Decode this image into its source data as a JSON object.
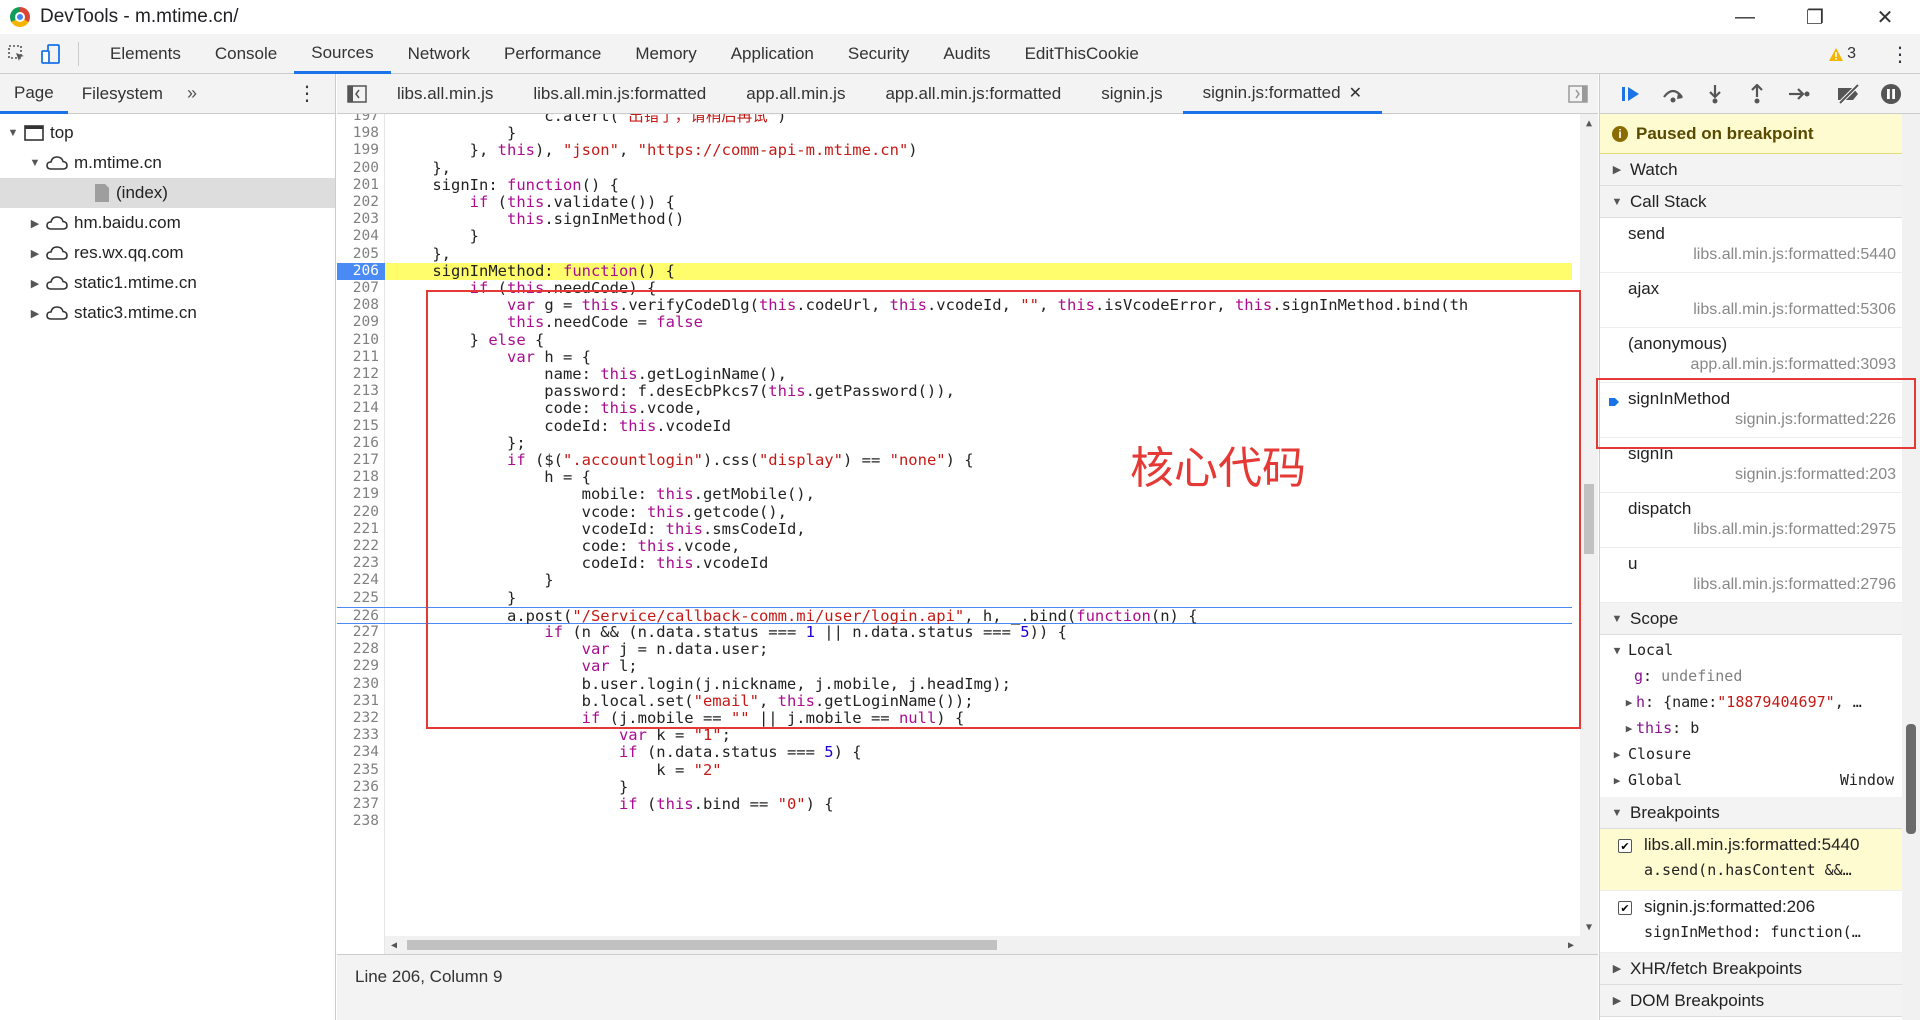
{
  "window": {
    "title": "DevTools - m.mtime.cn/",
    "controls": {
      "minimize": "—",
      "maximize": "❐",
      "close": "✕"
    }
  },
  "main_tabs": [
    "Elements",
    "Console",
    "Sources",
    "Network",
    "Performance",
    "Memory",
    "Application",
    "Security",
    "Audits",
    "EditThisCookie"
  ],
  "active_main_tab": "Sources",
  "warnings": {
    "count": "3"
  },
  "navigator": {
    "tabs": [
      "Page",
      "Filesystem"
    ],
    "more": "»",
    "tree": [
      {
        "label": "top",
        "level": 0,
        "type": "frame",
        "expanded": true
      },
      {
        "label": "m.mtime.cn",
        "level": 1,
        "type": "cloud",
        "expanded": true
      },
      {
        "label": "(index)",
        "level": 2,
        "type": "file",
        "selected": true
      },
      {
        "label": "hm.baidu.com",
        "level": 1,
        "type": "cloud",
        "expanded": false
      },
      {
        "label": "res.wx.qq.com",
        "level": 1,
        "type": "cloud",
        "expanded": false
      },
      {
        "label": "static1.mtime.cn",
        "level": 1,
        "type": "cloud",
        "expanded": false
      },
      {
        "label": "static3.mtime.cn",
        "level": 1,
        "type": "cloud",
        "expanded": false
      }
    ]
  },
  "file_tabs": [
    "libs.all.min.js",
    "libs.all.min.js:formatted",
    "app.all.min.js",
    "app.all.min.js:formatted",
    "signin.js",
    "signin.js:formatted"
  ],
  "active_file_tab": "signin.js:formatted",
  "status": {
    "position": "Line 206, Column 9"
  },
  "annotation": "核心代码",
  "code": {
    "breakpoint_line": 206,
    "exec_line": 206,
    "current_line": 226,
    "lines": [
      {
        "n": "197",
        "t": "                c.alert(\"出错了，请稍后再试\")"
      },
      {
        "n": "198",
        "t": "            }"
      },
      {
        "n": "199",
        "t": "        }, this), \"json\", \"https://comm-api-m.mtime.cn\")"
      },
      {
        "n": "200",
        "t": "    },"
      },
      {
        "n": "201",
        "t": "    signIn: function() {"
      },
      {
        "n": "202",
        "t": "        if (this.validate()) {"
      },
      {
        "n": "203",
        "t": "            this.signInMethod()"
      },
      {
        "n": "204",
        "t": "        }"
      },
      {
        "n": "205",
        "t": "    },"
      },
      {
        "n": "206",
        "t": "    signInMethod: function() {"
      },
      {
        "n": "207",
        "t": "        if (this.needCode) {"
      },
      {
        "n": "208",
        "t": "            var g = this.verifyCodeDlg(this.codeUrl, this.vcodeId, \"\", this.isVcodeError, this.signInMethod.bind(th"
      },
      {
        "n": "209",
        "t": "            this.needCode = false"
      },
      {
        "n": "210",
        "t": "        } else {"
      },
      {
        "n": "211",
        "t": "            var h = {"
      },
      {
        "n": "212",
        "t": "                name: this.getLoginName(),"
      },
      {
        "n": "213",
        "t": "                password: f.desEcbPkcs7(this.getPassword()),"
      },
      {
        "n": "214",
        "t": "                code: this.vcode,"
      },
      {
        "n": "215",
        "t": "                codeId: this.vcodeId"
      },
      {
        "n": "216",
        "t": "            };"
      },
      {
        "n": "217",
        "t": "            if ($(\".accountlogin\").css(\"display\") == \"none\") {"
      },
      {
        "n": "218",
        "t": "                h = {"
      },
      {
        "n": "219",
        "t": "                    mobile: this.getMobile(),"
      },
      {
        "n": "220",
        "t": "                    vcode: this.getcode(),"
      },
      {
        "n": "221",
        "t": "                    vcodeId: this.smsCodeId,"
      },
      {
        "n": "222",
        "t": "                    code: this.vcode,"
      },
      {
        "n": "223",
        "t": "                    codeId: this.vcodeId"
      },
      {
        "n": "224",
        "t": "                }"
      },
      {
        "n": "225",
        "t": "            }"
      },
      {
        "n": "226",
        "t": "            a.post(\"/Service/callback-comm.mi/user/login.api\", h, _.bind(function(n) {"
      },
      {
        "n": "227",
        "t": "                if (n && (n.data.status === 1 || n.data.status === 5)) {"
      },
      {
        "n": "228",
        "t": "                    var j = n.data.user;"
      },
      {
        "n": "229",
        "t": "                    var l;"
      },
      {
        "n": "230",
        "t": "                    b.user.login(j.nickname, j.mobile, j.headImg);"
      },
      {
        "n": "231",
        "t": "                    b.local.set(\"email\", this.getLoginName());"
      },
      {
        "n": "232",
        "t": "                    if (j.mobile == \"\" || j.mobile == null) {"
      },
      {
        "n": "233",
        "t": "                        var k = \"1\";"
      },
      {
        "n": "234",
        "t": "                        if (n.data.status === 5) {"
      },
      {
        "n": "235",
        "t": "                            k = \"2\""
      },
      {
        "n": "236",
        "t": "                        }"
      },
      {
        "n": "237",
        "t": "                        if (this.bind == \"0\") {"
      },
      {
        "n": "238",
        "t": ""
      }
    ]
  },
  "debugger": {
    "paused_text": "Paused on breakpoint",
    "sections": {
      "watch": "Watch",
      "call_stack": "Call Stack",
      "scope": "Scope",
      "breakpoints": "Breakpoints",
      "xhr": "XHR/fetch Breakpoints",
      "dom": "DOM Breakpoints"
    },
    "call_stack": [
      {
        "fn": "send",
        "loc": "libs.all.min.js:formatted:5440"
      },
      {
        "fn": "ajax",
        "loc": "libs.all.min.js:formatted:5306"
      },
      {
        "fn": "(anonymous)",
        "loc": "app.all.min.js:formatted:3093"
      },
      {
        "fn": "signInMethod",
        "loc": "signin.js:formatted:226",
        "current": true
      },
      {
        "fn": "signIn",
        "loc": "signin.js:formatted:203"
      },
      {
        "fn": "dispatch",
        "loc": "libs.all.min.js:formatted:2975"
      },
      {
        "fn": "u",
        "loc": "libs.all.min.js:formatted:2796"
      }
    ],
    "scope": {
      "local_label": "Local",
      "g_key": "g",
      "g_val": "undefined",
      "h_key": "h",
      "h_val_prefix": "{name: ",
      "h_val_str": "\"18879404697\"",
      "h_val_suffix": ", …",
      "this_key": "this",
      "this_val": "b",
      "closure_label": "Closure",
      "global_label": "Global",
      "global_val": "Window"
    },
    "breakpoints": [
      {
        "title": "libs.all.min.js:formatted:5440",
        "snippet": "a.send(n.hasContent &&…",
        "checked": true,
        "hit": true
      },
      {
        "title": "signin.js:formatted:206",
        "snippet": "signInMethod: function(…",
        "checked": true,
        "hit": false
      }
    ]
  },
  "colors": {
    "accent": "#1a73e8",
    "highlight": "#fffd6b",
    "annotation": "#e53935",
    "keyword": "#aa0d91",
    "string": "#c41a16"
  }
}
